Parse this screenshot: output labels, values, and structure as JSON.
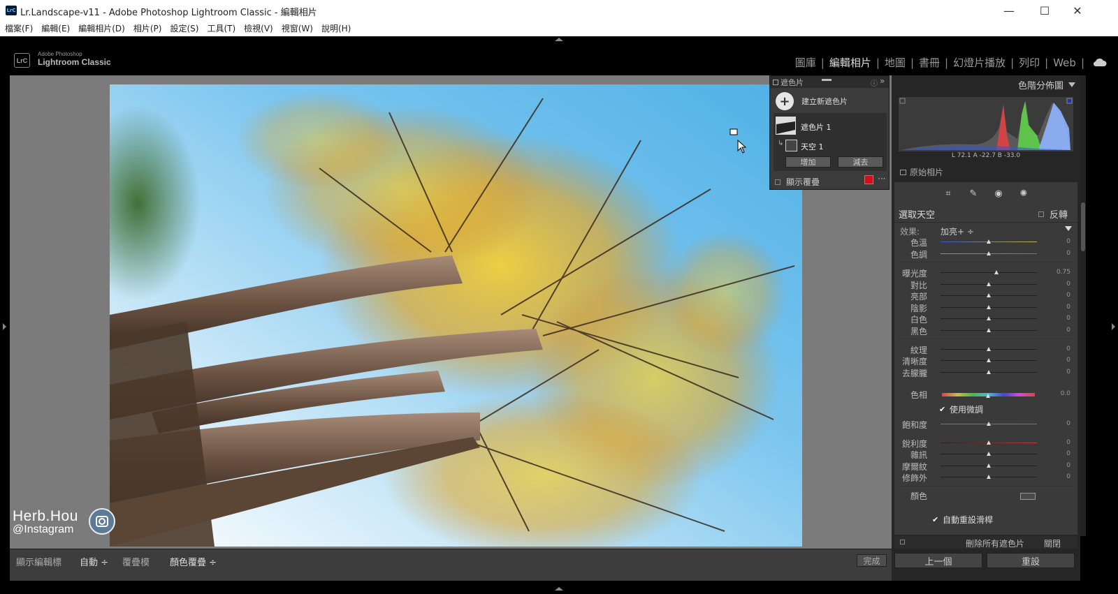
{
  "window": {
    "icon_text": "LrC",
    "title": "Lr.Landscape-v11 - Adobe Photoshop Lightroom Classic - 編輯相片",
    "minimize": "—",
    "maximize": "☐",
    "close": "✕"
  },
  "menu": [
    "檔案(F)",
    "編輯(E)",
    "編輯相片(D)",
    "相片(P)",
    "設定(S)",
    "工具(T)",
    "檢視(V)",
    "視窗(W)",
    "說明(H)"
  ],
  "brand": {
    "badge": "LrC",
    "line1": "Adobe Photoshop",
    "line2": "Lightroom Classic"
  },
  "modules": [
    {
      "label": "圖庫",
      "active": false
    },
    {
      "label": "編輯相片",
      "active": true
    },
    {
      "label": "地圖",
      "active": false
    },
    {
      "label": "書冊",
      "active": false
    },
    {
      "label": "幻燈片播放",
      "active": false
    },
    {
      "label": "列印",
      "active": false
    },
    {
      "label": "Web",
      "active": false
    }
  ],
  "watermark": {
    "name": "Herb.Hou",
    "handle": "@Instagram"
  },
  "mask_panel": {
    "title": "遮色片",
    "help": "ⓘ",
    "collapse": "»",
    "create_label": "建立新遮色片",
    "mask1_label": "遮色片 1",
    "sky_label": "天空 1",
    "add_button": "增加",
    "subtract_button": "減去",
    "show_overlay_label": "顯示覆疊",
    "overlay_color": "#d0101a",
    "more": "···"
  },
  "histogram": {
    "title": "色階分佈圖",
    "readout": "L   72.1   A   -22.7   B   -33.0",
    "original_photo_label": "原始相片"
  },
  "mask_settings": {
    "title": "選取天空",
    "invert_label": "反轉",
    "effect_label": "效果:",
    "effect_value": "加亮+ ÷"
  },
  "sliders": [
    {
      "label": "色溫",
      "value": "0",
      "pos": 0.5
    },
    {
      "label": "色調",
      "value": "0",
      "pos": 0.5
    },
    {
      "label": "曝光度",
      "value": "0.75",
      "pos": 0.59
    },
    {
      "label": "對比",
      "value": "0",
      "pos": 0.5
    },
    {
      "label": "亮部",
      "value": "0",
      "pos": 0.5
    },
    {
      "label": "陰影",
      "value": "0",
      "pos": 0.5
    },
    {
      "label": "白色",
      "value": "0",
      "pos": 0.5
    },
    {
      "label": "黑色",
      "value": "0",
      "pos": 0.5
    },
    {
      "label": "紋理",
      "value": "0",
      "pos": 0.5
    },
    {
      "label": "清晰度",
      "value": "0",
      "pos": 0.5
    },
    {
      "label": "去朦朧",
      "value": "0",
      "pos": 0.5
    },
    {
      "label": "色相",
      "value": "0.0",
      "pos": 0.5
    },
    {
      "label": "飽和度",
      "value": "0",
      "pos": 0.5
    },
    {
      "label": "銳利度",
      "value": "0",
      "pos": 0.5
    },
    {
      "label": "雜訊",
      "value": "0",
      "pos": 0.5
    },
    {
      "label": "摩爾紋",
      "value": "0",
      "pos": 0.5
    },
    {
      "label": "修飾外",
      "value": "0",
      "pos": 0.5
    }
  ],
  "fine_adjust_label": "使用微調",
  "color_label": "顏色",
  "auto_reset_label": "自動重設滑桿",
  "delete_all_label": "刪除所有遮色片",
  "close_label": "關閉",
  "prev_button": "上一個",
  "reset_button": "重設",
  "toolbar": {
    "show_pins_label": "顯示編輯標",
    "auto_value": "自動 ÷",
    "overlay_label": "覆疊模",
    "color_overlay_value": "顏色覆疊 ÷",
    "done_button": "完成"
  }
}
